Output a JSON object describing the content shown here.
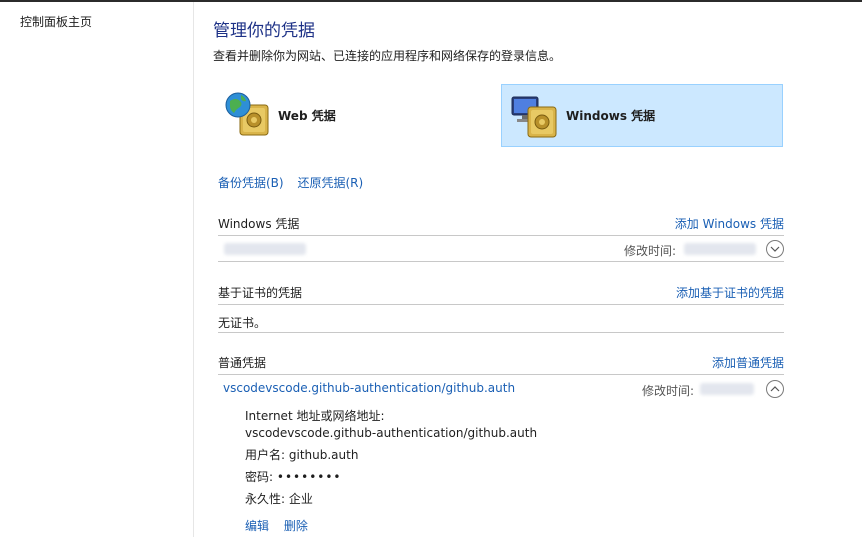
{
  "sidebar": {
    "home_link": "控制面板主页"
  },
  "header": {
    "title": "管理你的凭据",
    "subtitle": "查看并删除你为网站、已连接的应用程序和网络保存的登录信息。"
  },
  "credential_types": {
    "web": "Web 凭据",
    "windows": "Windows 凭据"
  },
  "toolbar": {
    "backup": "备份凭据(B)",
    "restore": "还原凭据(R)"
  },
  "sections": {
    "windows": {
      "name": "Windows 凭据",
      "add": "添加 Windows 凭据"
    },
    "certificate": {
      "name": "基于证书的凭据",
      "add": "添加基于证书的凭据",
      "empty": "无证书。"
    },
    "generic": {
      "name": "普通凭据",
      "add": "添加普通凭据"
    }
  },
  "windows_entry": {
    "modified_label": "修改时间:"
  },
  "generic_entry": {
    "name": "vscodevscode.github-authentication/github.auth",
    "modified_label": "修改时间:",
    "internet_label": "Internet 地址或网络地址:",
    "internet_value": "vscodevscode.github-authentication/github.auth",
    "username_label": "用户名:",
    "username_value": "github.auth",
    "password_label": "密码:",
    "password_value": "••••••••",
    "persistence_label": "永久性:",
    "persistence_value": "企业",
    "edit": "编辑",
    "delete": "删除"
  },
  "colors": {
    "link": "#1a5fb4",
    "title": "#1e3287",
    "selected_bg": "#cce8ff"
  },
  "icons": [
    "globe-vault-icon",
    "monitor-vault-icon",
    "chevron-down-icon",
    "chevron-up-icon"
  ]
}
